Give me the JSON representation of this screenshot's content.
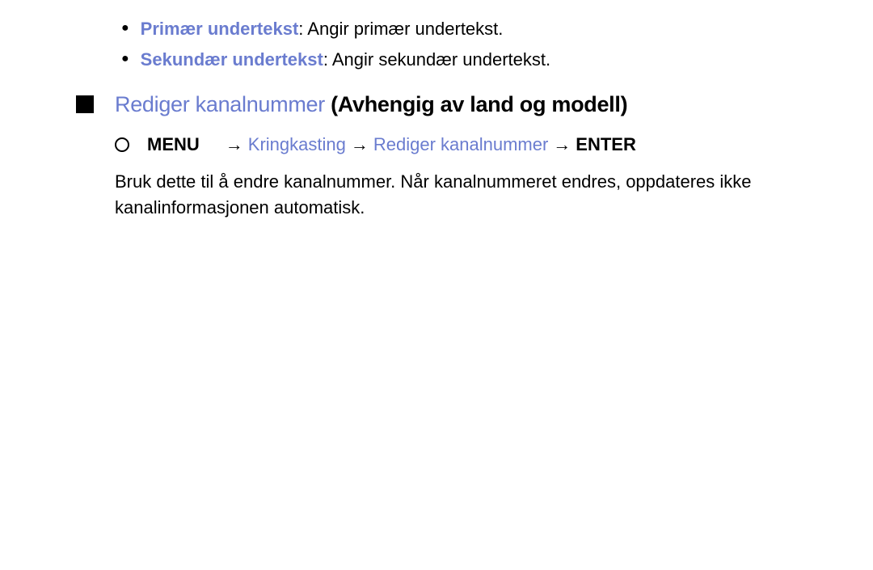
{
  "bullets": [
    {
      "label": "Primær undertekst",
      "desc": ": Angir primær undertekst."
    },
    {
      "label": "Sekundær undertekst",
      "desc": ": Angir sekundær undertekst."
    }
  ],
  "section": {
    "title_blue": "Rediger kanalnummer",
    "title_black": " (Avhengig av land og modell)"
  },
  "menu_path": {
    "menu": "MENU",
    "arrow1": "→",
    "kring": "Kringkasting",
    "arrow2": "→",
    "rediger": "Rediger kanalnummer",
    "arrow3": "→",
    "enter": "ENTER"
  },
  "paragraph": "Bruk dette til å endre kanalnummer. Når kanalnummeret endres, oppdateres ikke kanalinformasjonen automatisk."
}
